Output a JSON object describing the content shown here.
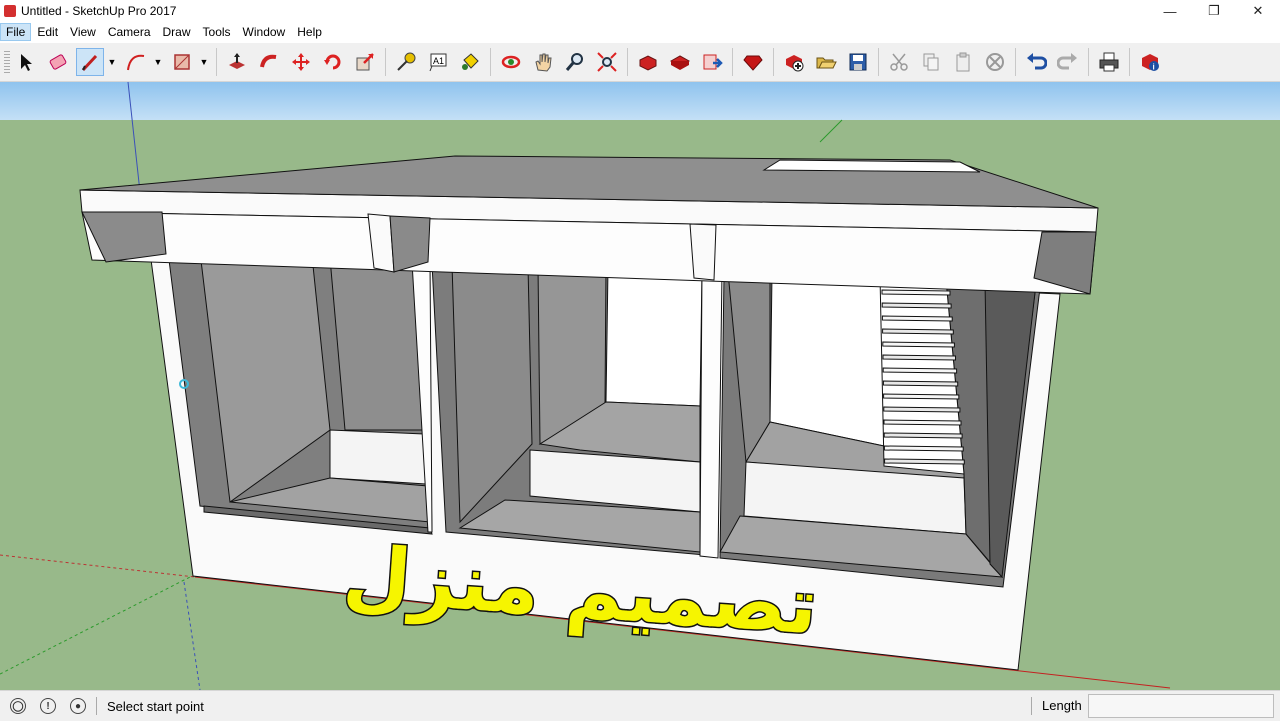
{
  "window": {
    "title": "Untitled - SketchUp Pro 2017",
    "controls": {
      "minimize": "—",
      "restore": "❐",
      "close": "✕"
    }
  },
  "menu": {
    "items": [
      "File",
      "Edit",
      "View",
      "Camera",
      "Draw",
      "Tools",
      "Window",
      "Help"
    ],
    "active": "File"
  },
  "toolbar": {
    "tools": [
      "select-icon",
      "eraser-icon",
      "line-icon",
      "arc-icon",
      "rectangle-icon",
      "push-pull-icon",
      "follow-me-icon",
      "move-icon",
      "rotate-icon",
      "scale-icon",
      "tape-measure-icon",
      "text-icon",
      "paint-bucket-icon",
      "orbit-icon",
      "pan-icon",
      "zoom-icon",
      "zoom-extents-icon",
      "warehouse-icon",
      "share-model-icon",
      "extension-warehouse-icon",
      "ruby-icon",
      "new-icon",
      "open-icon",
      "save-icon",
      "cut-icon",
      "copy-icon",
      "paste-icon",
      "delete-icon",
      "undo-icon",
      "redo-icon",
      "print-icon",
      "model-info-icon"
    ],
    "selected_tool": "line-icon"
  },
  "canvas": {
    "overlay_text": "تصميم منزل",
    "sky_color": "#a6cff0",
    "ground_color": "#98b98a",
    "overlay_text_color": "#f6f500"
  },
  "status": {
    "message": "Select start point",
    "measurement_label": "Length",
    "measurement_value": ""
  }
}
